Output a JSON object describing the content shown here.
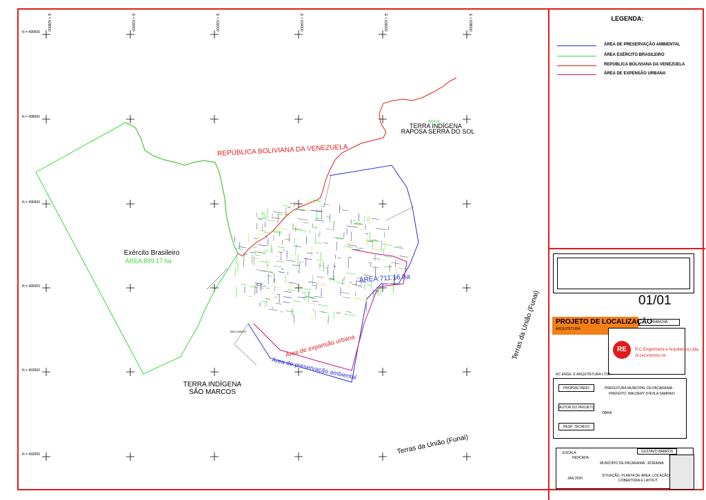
{
  "legend": {
    "title": "LEGENDA:",
    "items": [
      {
        "label": "ÁREA DE PRESERVAÇÃO AMBIENTAL",
        "color": "#2b2bd4"
      },
      {
        "label": "ÁREA EXÉRCITO BRASILEIRO",
        "color": "#36d936"
      },
      {
        "label": "REPÚBLICA BOLIVIANA DA VENEZUELA",
        "color": "#e01b1b"
      },
      {
        "label": "ÁREA DE EXPENSÃO URBANA",
        "color": "#c4177a"
      }
    ]
  },
  "grid": {
    "north_labels": [
      "N = 499500",
      "N = 498000",
      "N = 496500",
      "N = 495000",
      "N = 493500",
      "N = 492000"
    ],
    "east_labels": [
      "E = 628000",
      "E = 630000",
      "E = 632000",
      "E = 634000",
      "E = 636000",
      "E = 638000"
    ]
  },
  "map": {
    "venezuela_label": "REPÚBLICA BOLIVIANA DA VENEZUELA",
    "raposa_small": "BRASIL",
    "raposa_line1": "TERRA INDÍGENA",
    "raposa_line2": "RAPOSA SERRA DO SOL",
    "exercito_name": "Exército Brasileiro",
    "exercito_area": "ÁREA:899.17 ha",
    "urban_area": "ÁREA:711.16 ha",
    "expansion_label": "Área de expansão urbana",
    "preservation_label": "Área de preservação ambiental",
    "saomarcos_line1": "TERRA INDÍGENA",
    "saomarcos_line2": "SÃO MARCOS",
    "funai_bottom": "Terras da União (Funai)",
    "funai_right": "Terras da União (Funai)",
    "marker_label": "BR174/BR73",
    "colors": {
      "border": "#e01b1b",
      "army": "#36d936",
      "preservation": "#2b2bd4",
      "expansion": "#c4177a"
    }
  },
  "titleblock": {
    "sheet_number": "01/01",
    "sheet_label": "PRANCHA",
    "project_title": "PROJETO DE LOCALIZAÇÃO",
    "project_sub": "ARQUITETURA",
    "company_name": "R.C Engenharia e Arquitetura Ltda.",
    "company_cnpj": "09.543.926/0001-06",
    "company_short": "RC ENGE. E ARQUITETURA LTDA.",
    "logo_text": "RE",
    "proprietario_label": "PROPRIETÁRIO",
    "proprietario_value": "PREFEITURA MUNICIPAL DE PACARAIMA",
    "prefeito_value": "PREFEITO: WALDERY D'ÁVILA SAMPAIO",
    "autor_label": "AUTOR DO PROJETO",
    "obra_label": "OBRA:",
    "resp_label": "RESP. TÉCNICO",
    "escala_label": "ESCALA",
    "escala_value": "INDICADA",
    "data_value": "JAN 2020",
    "desenho_value": "GUSTAVO BARROS",
    "municipio_value": "MUNICÍPIO DE PACARAIMA - RORAIMA",
    "conteudo_line1": "SITUAÇÃO, PLANTA DE ÁREA, LOCAÇÃO,",
    "conteudo_line2": "COBERTURA E LAYOUT"
  }
}
